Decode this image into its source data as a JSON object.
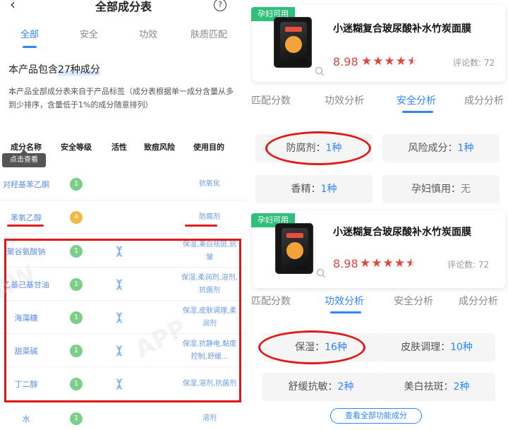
{
  "left": {
    "header": {
      "back": "‹",
      "title": "全部成分表",
      "help": "?"
    },
    "tabs": [
      "全部",
      "安全",
      "功效",
      "肤质匹配"
    ],
    "summary_prefix": "本产品包含",
    "summary_highlight": "27种成分",
    "note": "本产品全部成分表来自于产品标签（成分表根据单一成分含量从多到少排序，含量低于1%的成分随意排列）",
    "columns": [
      "成分名称",
      "安全等级",
      "活性",
      "致痘风险",
      "使用目的"
    ],
    "tooltip": "点击查看",
    "rows": [
      {
        "name": "对羟基苯乙酮",
        "level": "1",
        "active": false,
        "use": "抗氧化"
      },
      {
        "name": "苯氧乙醇",
        "level": "4",
        "active": false,
        "use": "防腐剂"
      },
      {
        "name": "聚谷氨酸钠",
        "level": "1",
        "active": true,
        "use": "保湿,美白祛斑,抗皱"
      },
      {
        "name": "乙基己基甘油",
        "level": "1",
        "active": true,
        "use": "保湿,柔润剂,溶剂,抗菌剂"
      },
      {
        "name": "海藻糖",
        "level": "1",
        "active": true,
        "use": "保湿,皮肤调理,柔润剂"
      },
      {
        "name": "甜菜碱",
        "level": "1",
        "active": true,
        "use": "保湿,抗静电,黏度控制,舒缓..."
      },
      {
        "name": "丁二醇",
        "level": "1",
        "active": true,
        "use": "保湿,溶剂,抗菌剂"
      },
      {
        "name": "水",
        "level": "1",
        "active": false,
        "use": "溶剂"
      }
    ],
    "colors": {
      "level_safe": "#7ccf8a",
      "level_mid": "#f5b942",
      "accent": "#2f86ff"
    }
  },
  "right": {
    "card1": {
      "badge": "孕妇可用",
      "name": "小迷糊复合玻尿酸补水竹炭面膜",
      "price": "8.98",
      "rating": 4.5,
      "stars": "★★★★",
      "half_star": "★",
      "reviews": "评论数: 72"
    },
    "tabs1": [
      "匹配分数",
      "功效分析",
      "安全分析",
      "成分分析"
    ],
    "safety": {
      "preservative_label": "防腐剂：",
      "preservative_value": "1种",
      "risk_label": "风险成分：",
      "risk_value": "1种",
      "fragrance_label": "香精：",
      "fragrance_value": "1种",
      "pregnancy_label": "孕妇慎用：",
      "pregnancy_value": "无"
    },
    "card2": {
      "badge": "孕妇可用",
      "name": "小迷糊复合玻尿酸补水竹炭面膜",
      "price": "8.98",
      "rating": 4.5,
      "stars": "★★★★",
      "half_star": "★",
      "reviews": "评论数: 72"
    },
    "tabs2": [
      "匹配分数",
      "功效分析",
      "安全分析",
      "成分分析"
    ],
    "efficacy": {
      "moist_label": "保湿：",
      "moist_value": "16种",
      "skin_label": "皮肤调理：",
      "skin_value": "10种",
      "soothe_label": "舒缓抗敏：",
      "soothe_value": "2种",
      "whiten_label": "美白祛斑：",
      "whiten_value": "2种"
    },
    "view_all": "查看全部功能成分"
  }
}
